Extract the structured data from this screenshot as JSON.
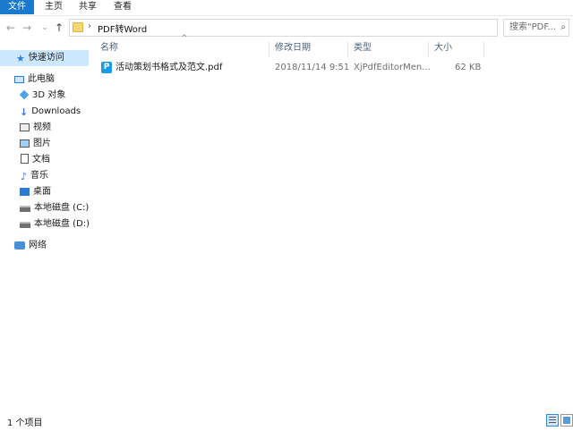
{
  "ribbon": {
    "tabs": [
      {
        "label": "文件",
        "active": true
      },
      {
        "label": "主页",
        "active": false
      },
      {
        "label": "共享",
        "active": false
      },
      {
        "label": "查看",
        "active": false
      }
    ]
  },
  "nav_buttons": {
    "back": "←",
    "forward": "→",
    "recent": "⌄",
    "up": "↑"
  },
  "address": {
    "path": [
      "PDF转Word"
    ],
    "separator": "›",
    "dropdown": "⌄",
    "refresh": "↻"
  },
  "search": {
    "placeholder": "搜索\"PDF...",
    "glyph": "⌕"
  },
  "nav_pane": {
    "items": [
      {
        "label": "快速访问",
        "icon": "star-icon",
        "selected": true
      },
      {
        "label": "此电脑",
        "icon": "computer-icon"
      },
      {
        "label": "3D 对象",
        "icon": "3d-objects-icon"
      },
      {
        "label": "Downloads",
        "icon": "download-icon"
      },
      {
        "label": "视频",
        "icon": "video-icon"
      },
      {
        "label": "图片",
        "icon": "pictures-icon"
      },
      {
        "label": "文档",
        "icon": "documents-icon"
      },
      {
        "label": "音乐",
        "icon": "music-icon"
      },
      {
        "label": "桌面",
        "icon": "desktop-icon"
      },
      {
        "label": "本地磁盘 (C:)",
        "icon": "drive-icon"
      },
      {
        "label": "本地磁盘 (D:)",
        "icon": "drive-icon"
      },
      {
        "label": "网络",
        "icon": "network-icon"
      }
    ]
  },
  "columns": {
    "name": "名称",
    "modified": "修改日期",
    "type": "类型",
    "size": "大小",
    "sort_indicator": "^"
  },
  "files": [
    {
      "name": "活动策划书格式及范文.pdf",
      "modified": "2018/11/14 9:51",
      "type": "XjPdfEditorMen...",
      "size": "62 KB",
      "icon_letter": "P"
    }
  ],
  "status": {
    "item_count": "1 个项目"
  },
  "colors": {
    "accent": "#1979ca",
    "selection": "#cce8ff"
  }
}
